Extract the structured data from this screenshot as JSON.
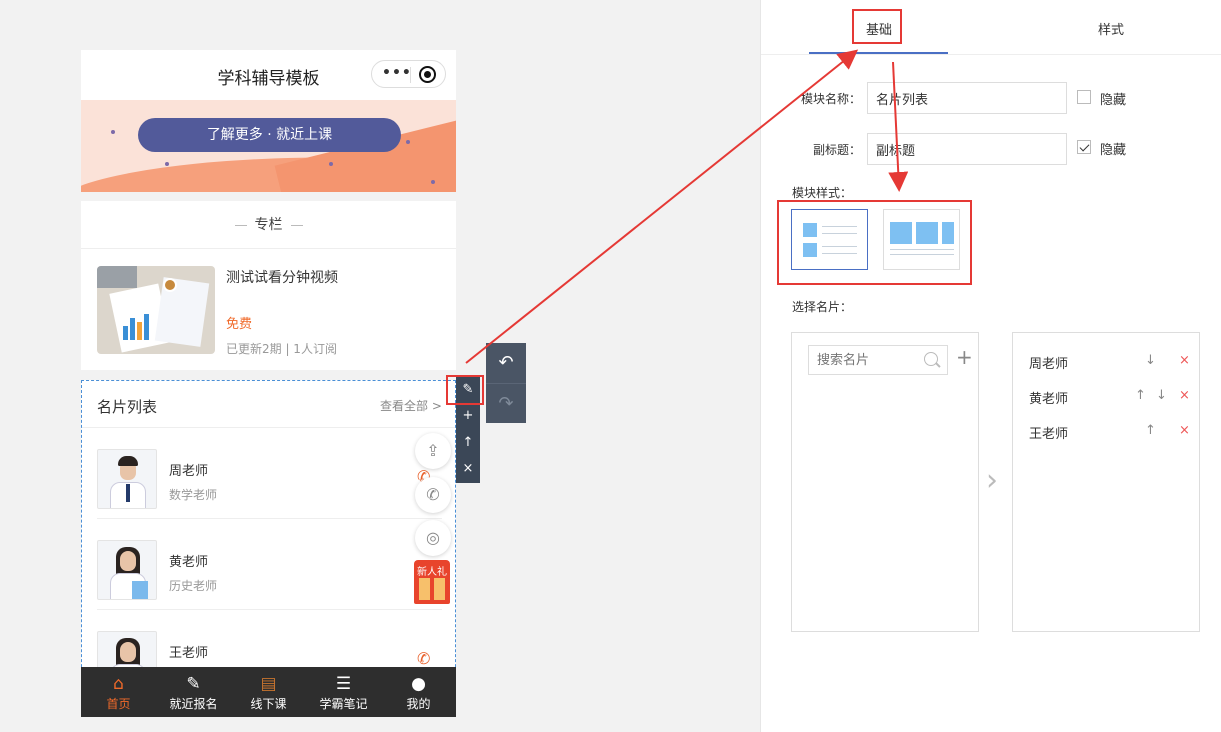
{
  "phone": {
    "title": "学科辅导模板",
    "capsule": {
      "more_glyph": "•••"
    },
    "banner": {
      "button_label": "了解更多 · 就近上课"
    },
    "column": {
      "header": "专栏",
      "course": {
        "title": "测试试看分钟视频",
        "price": "免费",
        "meta": "已更新2期 | 1人订阅"
      }
    },
    "card_list": {
      "title": "名片列表",
      "more": "查看全部 >",
      "teachers": [
        {
          "name": "周老师",
          "role": "数学老师"
        },
        {
          "name": "黄老师",
          "role": "历史老师"
        },
        {
          "name": "王老师",
          "role": ""
        }
      ]
    },
    "gift_label": "新人礼",
    "tabbar": [
      {
        "label": "首页",
        "icon": "home-icon",
        "glyph": "⌂"
      },
      {
        "label": "就近报名",
        "icon": "edit-form-icon",
        "glyph": "✎"
      },
      {
        "label": "线下课",
        "icon": "book-icon",
        "glyph": "▤"
      },
      {
        "label": "学霸笔记",
        "icon": "note-icon",
        "glyph": "☰"
      },
      {
        "label": "我的",
        "icon": "user-icon",
        "glyph": "●"
      }
    ],
    "accent": "#f06a2a"
  },
  "module_toolbar": {
    "edit": "✎",
    "add": "+",
    "move_up": "↑",
    "delete": "×"
  },
  "history_toolbar": {
    "undo": "↶",
    "redo": "↷"
  },
  "panel": {
    "tabs": [
      "基础",
      "样式"
    ],
    "module_name_label": "模块名称：",
    "module_name_value": "名片列表",
    "subtitle_label": "副标题：",
    "subtitle_value": "副标题",
    "hide_label": "隐藏",
    "subtitle_hidden": true,
    "module_style_label": "模块样式：",
    "select_cards_label": "选择名片：",
    "search_placeholder": "搜索名片",
    "selected": [
      {
        "name": "周老师",
        "up": "",
        "down": "↓",
        "del": "×"
      },
      {
        "name": "黄老师",
        "up": "↑",
        "down": "↓",
        "del": "×"
      },
      {
        "name": "王老师",
        "up": "↑",
        "down": "",
        "del": "×"
      }
    ]
  },
  "colors": {
    "highlight": "#e53935",
    "primary": "#4a6fc4",
    "banner_button": "#525a9a"
  }
}
